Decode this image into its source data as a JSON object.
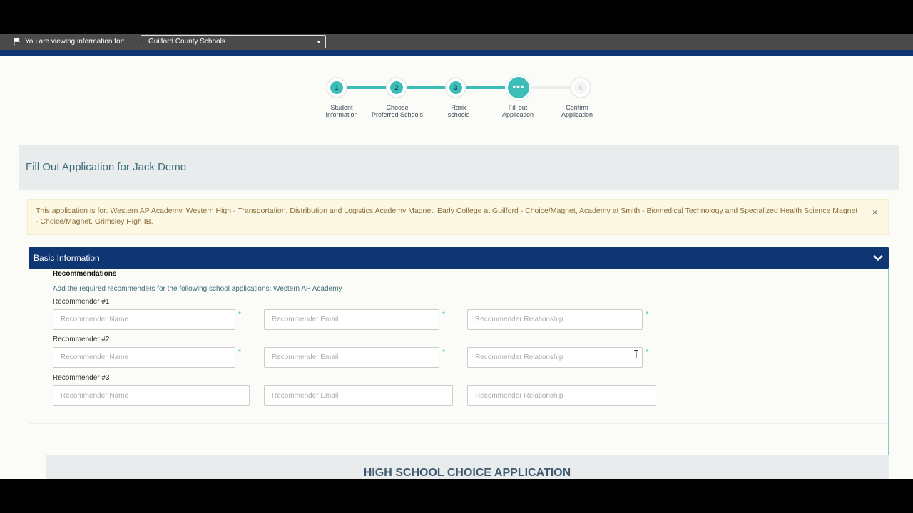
{
  "viewbar": {
    "label": "You are viewing information for:",
    "district": "Guilford County Schools"
  },
  "stepper": {
    "steps": [
      {
        "num": "1",
        "label_line1": "Student",
        "label_line2": "Information",
        "state": "done"
      },
      {
        "num": "2",
        "label_line1": "Choose",
        "label_line2": "Preferred Schools",
        "state": "done"
      },
      {
        "num": "3",
        "label_line1": "Rank",
        "label_line2": "schools",
        "state": "done"
      },
      {
        "num": "•••",
        "label_line1": "Fill out",
        "label_line2": "Application",
        "state": "current"
      },
      {
        "num": "5",
        "label_line1": "Confirm",
        "label_line2": "Application",
        "state": "pending"
      }
    ]
  },
  "header": {
    "title": "Fill Out Application for Jack Demo"
  },
  "alert": {
    "text": "This application is for: Western AP Academy, Western High - Transportation, Distribution and Logistics Academy Magnet, Early College at Guilford - Choice/Magnet, Academy at Smith - Biomedical Technology and Specialized Health Science Magnet - Choice/Magnet, Grimsley High IB.",
    "close": "×"
  },
  "section": {
    "title": "Basic Information",
    "recommendations_title": "Recommendations",
    "recommendations_desc": "Add the required recommenders for the following school applications: Western AP Academy",
    "recommenders": [
      {
        "label": "Recommender #1",
        "name_ph": "Recommender Name",
        "email_ph": "Recommender Email",
        "rel_ph": "Recommender Relationship",
        "required": "*"
      },
      {
        "label": "Recommender #2",
        "name_ph": "Recommender Name",
        "email_ph": "Recommender Email",
        "rel_ph": "Recommender Relationship",
        "required": "*"
      },
      {
        "label": "Recommender #3",
        "name_ph": "Recommender Name",
        "email_ph": "Recommender Email",
        "rel_ph": "Recommender Relationship"
      }
    ]
  },
  "banner": {
    "title": "HIGH SCHOOL CHOICE APPLICATION"
  },
  "colors": {
    "navy": "#0f3573",
    "teal": "#3dbdb7",
    "alert_bg": "#fcf8e3",
    "alert_text": "#8a6d3b"
  }
}
